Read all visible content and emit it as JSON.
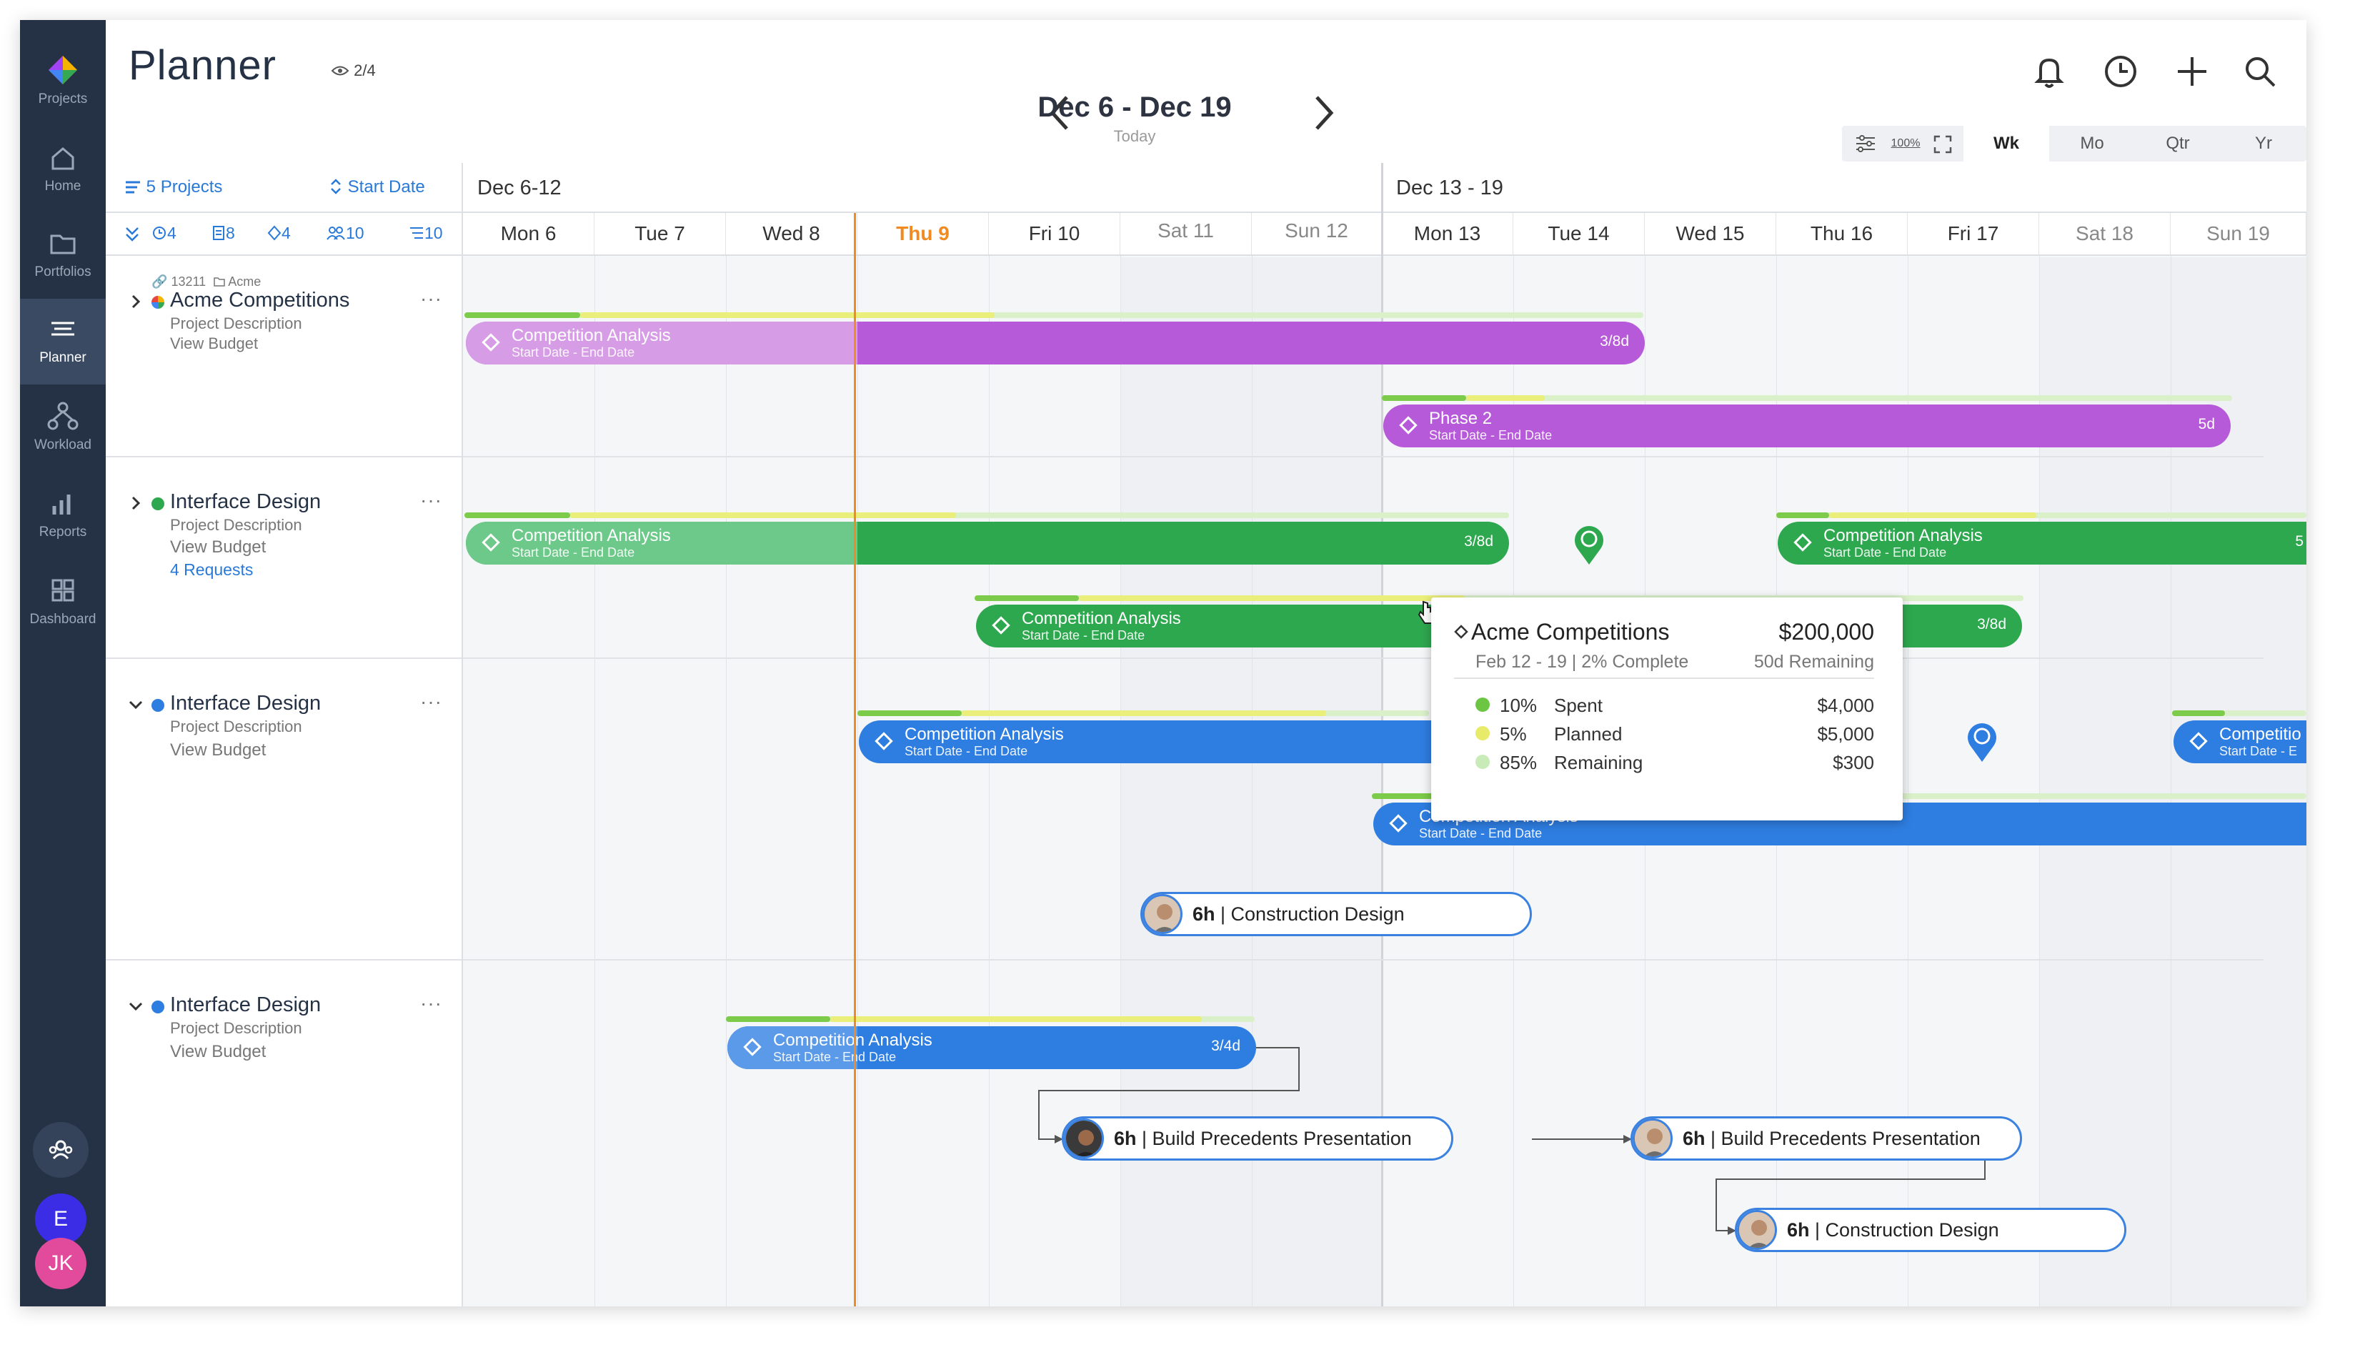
{
  "sidebar": {
    "items": [
      {
        "label": "Projects",
        "icon": "projects-logo-icon"
      },
      {
        "label": "Home",
        "icon": "home-icon"
      },
      {
        "label": "Portfolios",
        "icon": "folder-icon"
      },
      {
        "label": "Planner",
        "icon": "planner-icon"
      },
      {
        "label": "Workload",
        "icon": "workload-icon"
      },
      {
        "label": "Reports",
        "icon": "bar-chart-icon"
      },
      {
        "label": "Dashboard",
        "icon": "dashboard-icon"
      }
    ],
    "user_initial": "E",
    "user2_initials": "JK",
    "active": "Planner"
  },
  "header": {
    "title": "Planner",
    "views": "2/4",
    "range": "Dec 6 - Dec 19",
    "today": "Today",
    "zoom": {
      "percent": "100%",
      "options": [
        "Wk",
        "Mo",
        "Qtr",
        "Yr"
      ],
      "selected": "Wk"
    }
  },
  "filters": {
    "projects": "5 Projects",
    "sort": "Start Date",
    "counts": [
      "4",
      "8",
      "4",
      "10",
      "10"
    ]
  },
  "weeks": [
    "Dec 6-12",
    "Dec 13 - 19"
  ],
  "days": [
    "Mon 6",
    "Tue 7",
    "Wed 8",
    "Thu 9",
    "Fri 10",
    "Sat 11",
    "Sun 12",
    "Mon 13",
    "Tue 14",
    "Wed 15",
    "Thu 16",
    "Fri 17",
    "Sat 18",
    "Sun 19"
  ],
  "projects": [
    {
      "id": "13211",
      "folder": "Acme",
      "name": "Acme Competitions",
      "desc": "Project Description",
      "budget": "View Budget",
      "color": "multi"
    },
    {
      "name": "Interface Design",
      "desc": "Project Description",
      "budget": "View Budget",
      "requests": "4 Requests",
      "color": "#2ea84f"
    },
    {
      "name": "Interface Design",
      "desc": "Project Description",
      "budget": "View Budget",
      "color": "#2e7de0"
    },
    {
      "name": "Interface Design",
      "desc": "Project Description",
      "budget": "View Budget",
      "color": "#2e7de0"
    }
  ],
  "bars": {
    "b1": {
      "title": "Competition Analysis",
      "dates": "Start Date - End Date",
      "dur": "3/8d"
    },
    "b2": {
      "title": "Phase 2",
      "dates": "Start Date - End Date",
      "dur": "5d"
    },
    "b3": {
      "title": "Competition Analysis",
      "dates": "Start Date - End Date",
      "dur": "3/8d"
    },
    "b4": {
      "title": "Competition Analysis",
      "dates": "Start Date - End Date",
      "dur": "5"
    },
    "b5": {
      "title": "Competition Analysis",
      "dates": "Start Date - End Date",
      "dur": "3/8d"
    },
    "b6": {
      "title": "Competition Analysis",
      "dates": "Start Date - End Date"
    },
    "b7": {
      "title": "Competitio",
      "dates": "Start Date - E"
    },
    "b8": {
      "title": "Competition Analysis",
      "dates": "Start Date - End Date"
    },
    "b9": {
      "title": "Competition Analysis",
      "dates": "Start Date - End Date",
      "dur": "3/4d"
    }
  },
  "pills": {
    "p1": {
      "hours": "6h",
      "task": "Construction Design"
    },
    "p2": {
      "hours": "6h",
      "task": "Build Precedents Presentation"
    },
    "p3": {
      "hours": "6h",
      "task": "Build Precedents Presentation"
    },
    "p4": {
      "hours": "6h",
      "task": "Construction Design"
    }
  },
  "tooltip": {
    "title": "Acme Competitions",
    "amount": "$200,000",
    "dates": "Feb 12 - 19 | 2% Complete",
    "remaining": "50d Remaining",
    "rows": [
      {
        "pct": "10%",
        "label": "Spent",
        "value": "$4,000",
        "color": "#6cc644"
      },
      {
        "pct": "5%",
        "label": "Planned",
        "value": "$5,000",
        "color": "#e8ea6a"
      },
      {
        "pct": "85%",
        "label": "Remaining",
        "value": "$300",
        "color": "#c9ebb8"
      }
    ]
  },
  "colors": {
    "accent": "#2979d8",
    "today": "#f08a22",
    "purple": "#b75ad9",
    "green": "#2ea84f",
    "blue": "#2e7de0",
    "sidebar": "#253246"
  }
}
